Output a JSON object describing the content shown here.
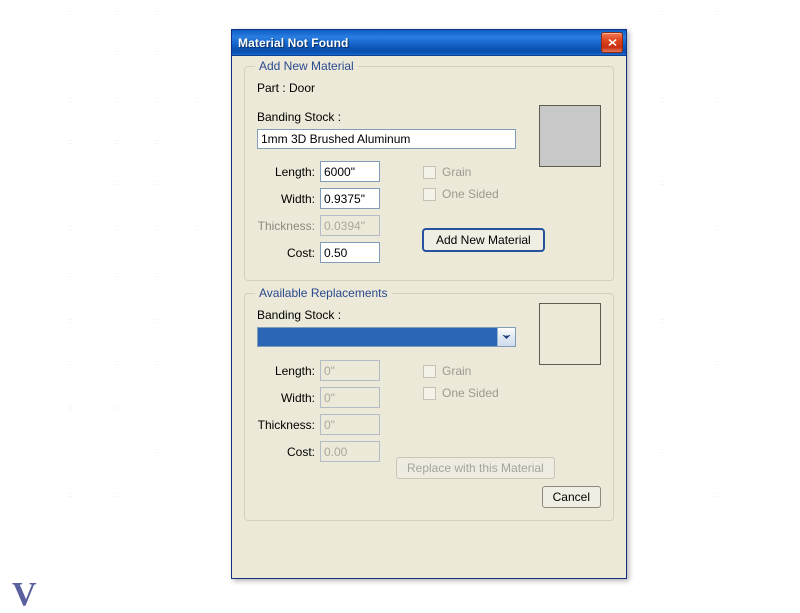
{
  "window": {
    "title": "Material Not Found",
    "close_icon": "close-x-icon"
  },
  "colors": {
    "titlebar_blue": "#1565cb",
    "dialog_face": "#ece9d8",
    "legend_blue": "#2a4a8f",
    "selection_blue": "#2a66b5",
    "close_red": "#e34a20",
    "swatch_gray": "#c8c8c8"
  },
  "add_new_material": {
    "legend": "Add New Material",
    "part_text": "Part : Door",
    "banding_stock_caption": "Banding Stock :",
    "banding_stock_value": "1mm 3D Brushed Aluminum",
    "banding_stock_placeholder": "",
    "swatch_color": "#c8c8c8",
    "fields": [
      {
        "label": "Length:",
        "value": "6000\"",
        "disabled": false
      },
      {
        "label": "Width:",
        "value": "0.9375\"",
        "disabled": false
      },
      {
        "label": "Thickness:",
        "value": "0.0394\"",
        "disabled": true
      },
      {
        "label": "Cost:",
        "value": "0.50",
        "disabled": false
      }
    ],
    "checkboxes": [
      {
        "label": "Grain",
        "checked": false,
        "disabled": true
      },
      {
        "label": "One Sided",
        "checked": false,
        "disabled": true
      }
    ],
    "button_label": "Add New Material"
  },
  "available_replacements": {
    "legend": "Available Replacements",
    "banding_stock_caption": "Banding Stock :",
    "banding_stock_value": "",
    "dropdown_icon": "chevron-down-icon",
    "swatch_color": "#ece9d8",
    "fields": [
      {
        "label": "Length:",
        "value": "0\"",
        "disabled": true
      },
      {
        "label": "Width:",
        "value": "0\"",
        "disabled": true
      },
      {
        "label": "Thickness:",
        "value": "0\"",
        "disabled": true
      },
      {
        "label": "Cost:",
        "value": "0.00",
        "disabled": true
      }
    ],
    "checkboxes": [
      {
        "label": "Grain",
        "checked": false,
        "disabled": true
      },
      {
        "label": "One Sided",
        "checked": false,
        "disabled": true
      }
    ],
    "button_label": "Replace with this Material",
    "cancel_label": "Cancel"
  }
}
